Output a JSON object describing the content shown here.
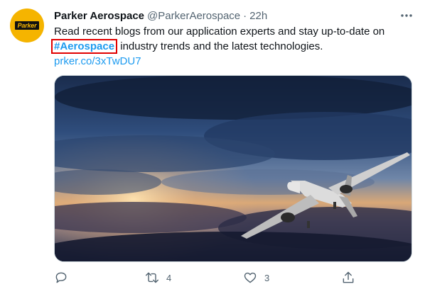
{
  "tweet": {
    "author_name": "Parker Aerospace",
    "handle": "@ParkerAerospace",
    "separator": "·",
    "time": "22h",
    "avatar_text": "Parker",
    "text_line1": "Read recent blogs from our application experts and stay up-to-date on",
    "hashtag": "#Aerospace",
    "text_after_hashtag": " industry trends and the latest technologies.",
    "link": "prker.co/3xTwDU7"
  },
  "actions": {
    "reply_count": "",
    "retweet_count": "4",
    "like_count": "3"
  },
  "icons": [
    "more-icon",
    "reply-icon",
    "retweet-icon",
    "like-icon",
    "share-icon"
  ],
  "colors": {
    "link": "#1d9bf0",
    "highlight_box": "#e10000",
    "muted": "#536471",
    "avatar_bg": "#f5b400"
  }
}
